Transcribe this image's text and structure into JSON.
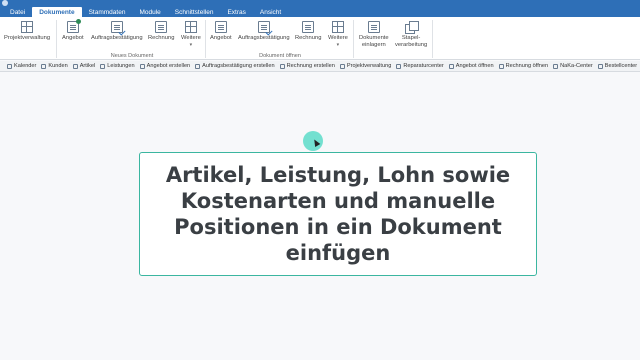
{
  "ribbon_tabs": [
    {
      "label": "Datei",
      "active": false
    },
    {
      "label": "Dokumente",
      "active": true
    },
    {
      "label": "Stammdaten",
      "active": false
    },
    {
      "label": "Module",
      "active": false
    },
    {
      "label": "Schnittstellen",
      "active": false
    },
    {
      "label": "Extras",
      "active": false
    },
    {
      "label": "Ansicht",
      "active": false
    }
  ],
  "ribbon": {
    "projektverwaltung": "Projektverwaltung",
    "neues_dokument": {
      "label": "Neues Dokument",
      "angebot": "Angebot",
      "auftragsbestaetigung": "Auftragsbestätigung",
      "rechnung": "Rechnung",
      "weitere": "Weitere"
    },
    "dokument_oeffnen": {
      "label": "Dokument öffnen",
      "angebot": "Angebot",
      "auftragsbestaetigung": "Auftragsbestätigung",
      "rechnung": "Rechnung",
      "weitere": "Weitere"
    },
    "dokumente_einlagern_1": "Dokumente",
    "dokumente_einlagern_2": "einlagern",
    "stapelverarbeitung_1": "Stapel-",
    "stapelverarbeitung_2": "verarbeitung"
  },
  "quickbar": [
    "Kalender",
    "Kunden",
    "Artikel",
    "Leistungen",
    "Angebot erstellen",
    "Auftragsbestätigung erstellen",
    "Rechnung erstellen",
    "Projektverwaltung",
    "Reparaturcenter",
    "Angebot öffnen",
    "Rechnung öffnen",
    "NaKa-Center",
    "Bestellcenter"
  ],
  "callout": {
    "text": "Artikel, Leistung, Lohn sowie Kostenarten und manuelle Positionen in ein Dokument einfügen"
  },
  "colors": {
    "ribbon_blue": "#2e6fb7",
    "callout_border": "#3bb6a0",
    "cursor_highlight": "#5cdcc8"
  }
}
